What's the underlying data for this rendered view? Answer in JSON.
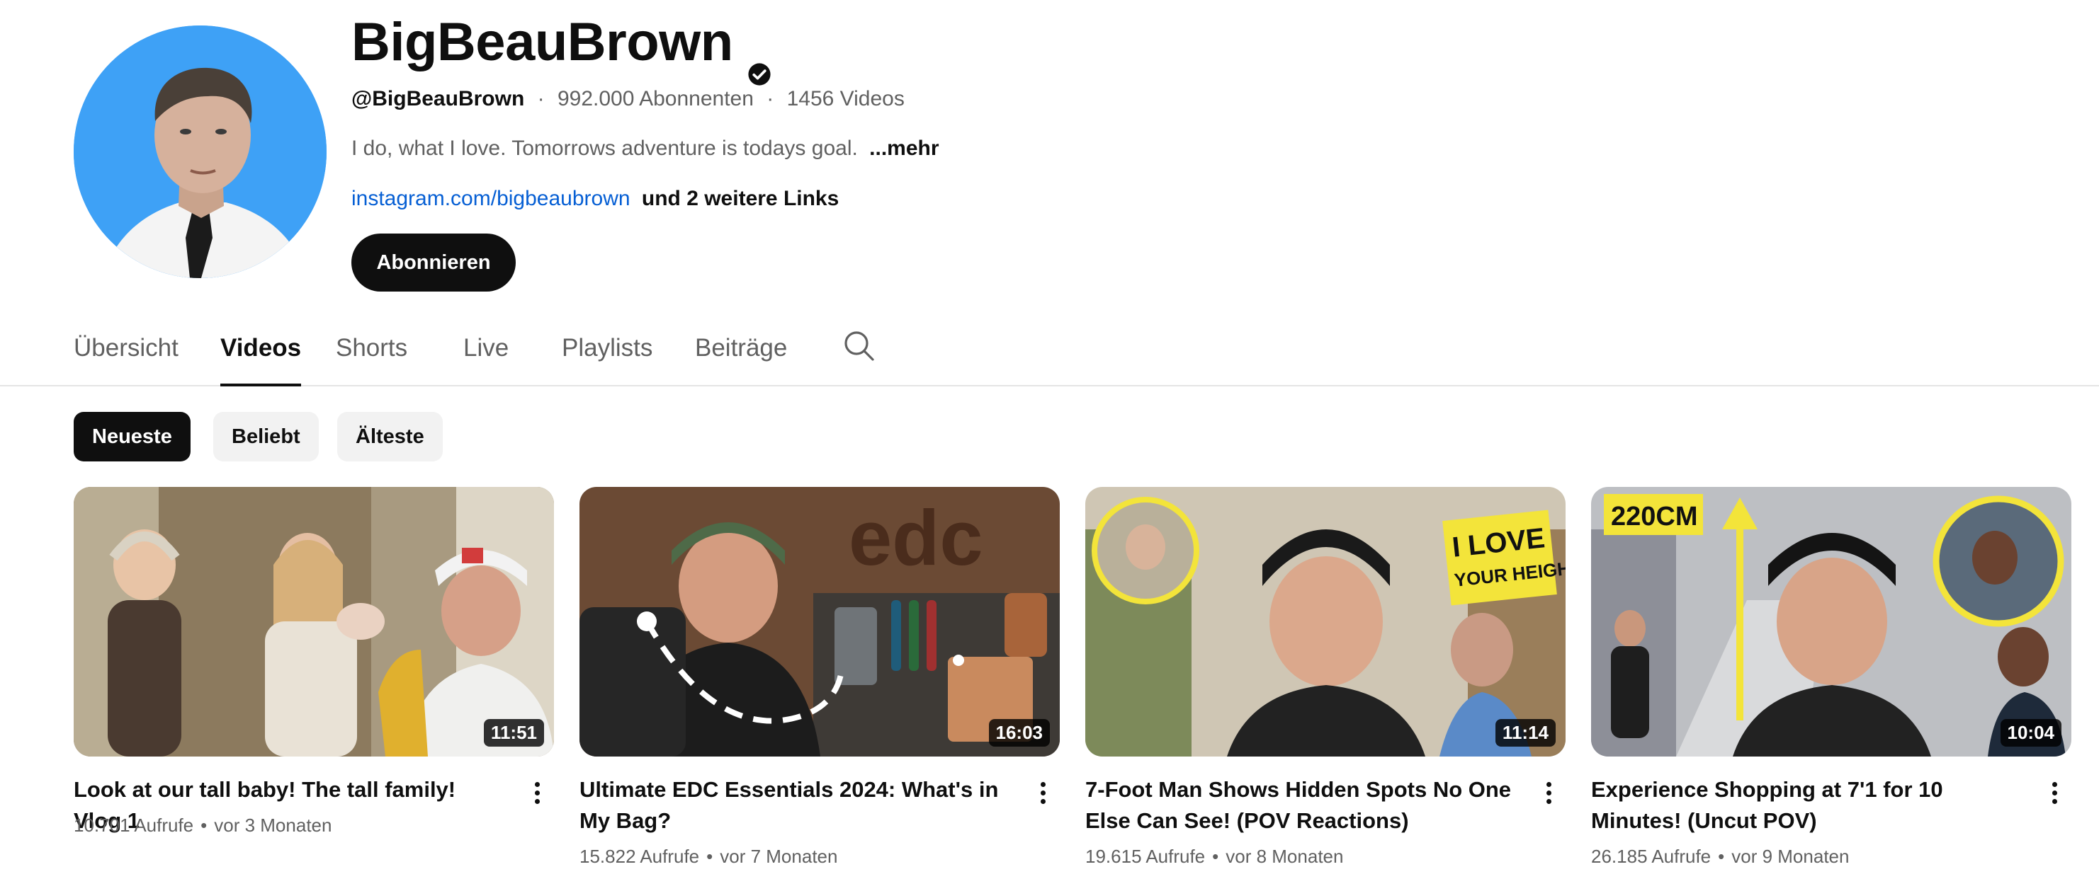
{
  "channel": {
    "name": "BigBeauBrown",
    "handle": "@BigBeauBrown",
    "subscribers": "992.000 Abonnenten",
    "video_count": "1456 Videos",
    "separator": "·",
    "description": "I do, what I love. Tomorrows adventure is todays goal.",
    "more_label": "...mehr",
    "link": "instagram.com/bigbeaubrown",
    "more_links": "und 2 weitere Links",
    "subscribe_label": "Abonnieren",
    "avatar_bg": "#3ea1f6"
  },
  "tabs": [
    {
      "label": "Übersicht",
      "active": false
    },
    {
      "label": "Videos",
      "active": true
    },
    {
      "label": "Shorts",
      "active": false
    },
    {
      "label": "Live",
      "active": false
    },
    {
      "label": "Playlists",
      "active": false
    },
    {
      "label": "Beiträge",
      "active": false
    }
  ],
  "search_icon": "search-icon",
  "chips": [
    {
      "label": "Neueste",
      "selected": true
    },
    {
      "label": "Beliebt",
      "selected": false
    },
    {
      "label": "Älteste",
      "selected": false
    }
  ],
  "videos": [
    {
      "title": "Look at our tall baby! The tall family! Vlog 1",
      "views": "10.701 Aufrufe",
      "age": "vor 3 Monaten",
      "duration": "11:51"
    },
    {
      "title": "Ultimate EDC Essentials 2024: What's in My Bag?",
      "views": "15.822 Aufrufe",
      "age": "vor 7 Monaten",
      "duration": "16:03",
      "thumb_text": "edc"
    },
    {
      "title": "7-Foot Man Shows Hidden Spots No One Else Can See! (POV Reactions)",
      "views": "19.615 Aufrufe",
      "age": "vor 8 Monaten",
      "duration": "11:14",
      "thumb_text": [
        "I LOVE",
        "YOUR HEIGHT"
      ]
    },
    {
      "title": "Experience Shopping at 7'1 for 10 Minutes! (Uncut POV)",
      "views": "26.185 Aufrufe",
      "age": "vor 9 Monaten",
      "duration": "10:04",
      "thumb_text": "220CM"
    }
  ],
  "stat_separator": "•"
}
